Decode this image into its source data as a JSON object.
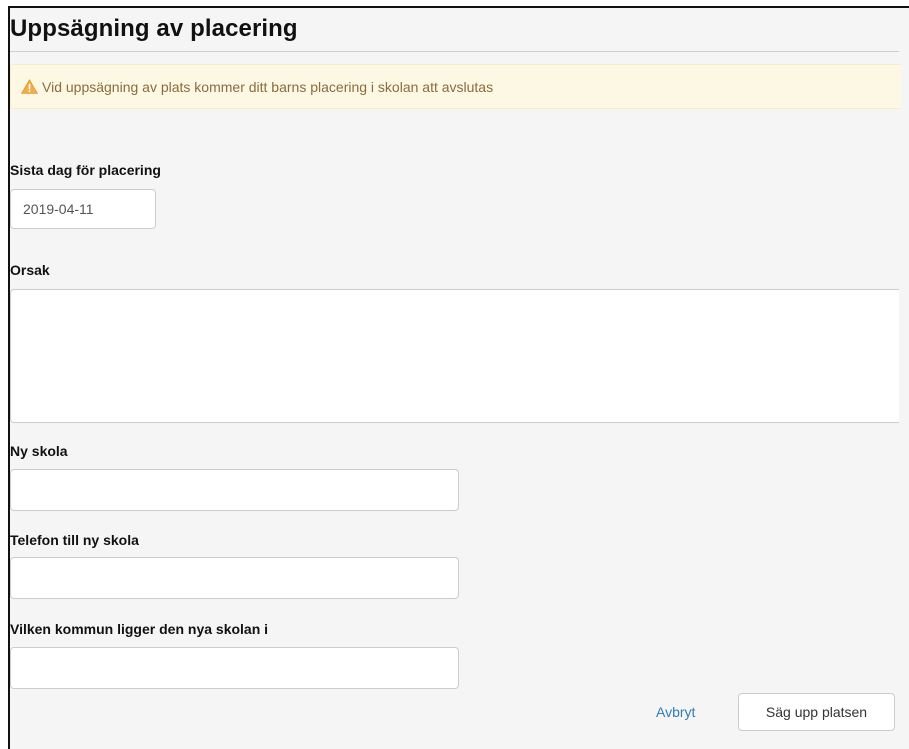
{
  "header": {
    "title": "Uppsägning av placering"
  },
  "alert": {
    "text": "Vid uppsägning av plats kommer ditt barns placering i skolan att avslutas"
  },
  "form": {
    "last_day": {
      "label": "Sista dag för placering",
      "value": "2019-04-11"
    },
    "reason": {
      "label": "Orsak",
      "value": ""
    },
    "new_school": {
      "label": "Ny skola",
      "value": ""
    },
    "new_school_phone": {
      "label": "Telefon till ny skola",
      "value": ""
    },
    "new_school_municipality": {
      "label": "Vilken kommun ligger den nya skolan i",
      "value": ""
    }
  },
  "actions": {
    "cancel_label": "Avbryt",
    "submit_label": "Säg upp platsen"
  },
  "colors": {
    "alert_bg": "#fcf8e3",
    "alert_text": "#8a6d3b",
    "link": "#337ab7",
    "warning_icon": "#f0ad4e"
  },
  "icons": {
    "alert": "warning-triangle-icon"
  }
}
